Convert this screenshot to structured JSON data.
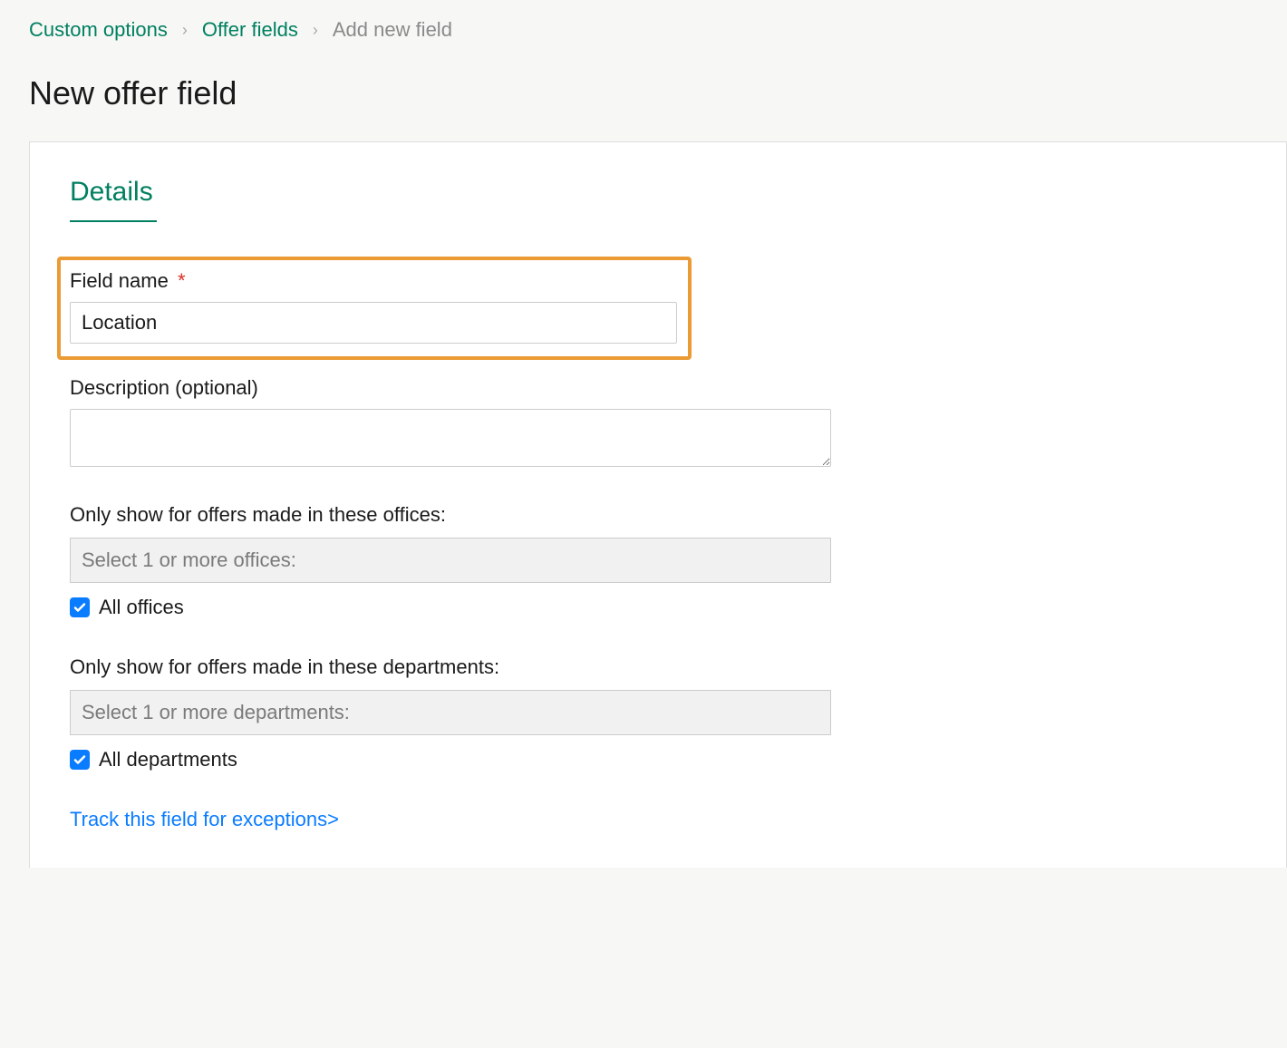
{
  "breadcrumb": {
    "items": [
      {
        "label": "Custom options"
      },
      {
        "label": "Offer fields"
      }
    ],
    "current": "Add new field"
  },
  "page_title": "New offer field",
  "section_title": "Details",
  "field_name": {
    "label": "Field name",
    "required_marker": "*",
    "value": "Location"
  },
  "description": {
    "label": "Description (optional)",
    "value": ""
  },
  "offices": {
    "label": "Only show for offers made in these offices:",
    "placeholder": "Select 1 or more offices:",
    "checkbox_label": "All offices",
    "checked": true
  },
  "departments": {
    "label": "Only show for offers made in these departments:",
    "placeholder": "Select 1 or more departments:",
    "checkbox_label": "All departments",
    "checked": true
  },
  "track_link": "Track this field for exceptions>"
}
